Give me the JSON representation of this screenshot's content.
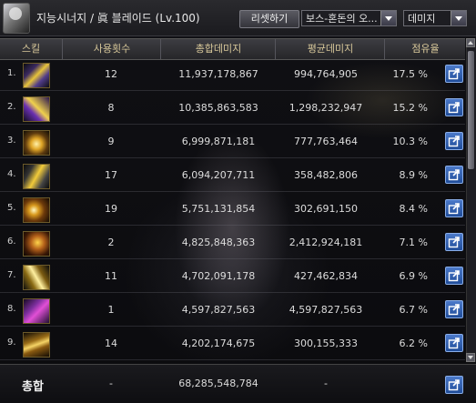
{
  "header": {
    "character_title": "지능시너지 / 眞 블레이드 (Lv.100)",
    "reset_button_label": "리셋하기",
    "dungeon_select_value": "보스-혼돈의 오...",
    "metric_select_value": "데미지"
  },
  "columns": {
    "skill": "스킬",
    "uses": "사용횟수",
    "total_damage": "총합데미지",
    "avg_damage": "평균데미지",
    "share": "점유율"
  },
  "rows": [
    {
      "rank": "1.",
      "uses": "12",
      "total": "11,937,178,867",
      "avg": "994,764,905",
      "pct": "17.5 %",
      "icon": "skill-icon-1"
    },
    {
      "rank": "2.",
      "uses": "8",
      "total": "10,385,863,583",
      "avg": "1,298,232,947",
      "pct": "15.2 %",
      "icon": "skill-icon-2"
    },
    {
      "rank": "3.",
      "uses": "9",
      "total": "6,999,871,181",
      "avg": "777,763,464",
      "pct": "10.3 %",
      "icon": "skill-icon-3"
    },
    {
      "rank": "4.",
      "uses": "17",
      "total": "6,094,207,711",
      "avg": "358,482,806",
      "pct": "8.9 %",
      "icon": "skill-icon-4"
    },
    {
      "rank": "5.",
      "uses": "19",
      "total": "5,751,131,854",
      "avg": "302,691,150",
      "pct": "8.4 %",
      "icon": "skill-icon-5"
    },
    {
      "rank": "6.",
      "uses": "2",
      "total": "4,825,848,363",
      "avg": "2,412,924,181",
      "pct": "7.1 %",
      "icon": "skill-icon-6"
    },
    {
      "rank": "7.",
      "uses": "11",
      "total": "4,702,091,178",
      "avg": "427,462,834",
      "pct": "6.9 %",
      "icon": "skill-icon-7"
    },
    {
      "rank": "8.",
      "uses": "1",
      "total": "4,597,827,563",
      "avg": "4,597,827,563",
      "pct": "6.7 %",
      "icon": "skill-icon-8"
    },
    {
      "rank": "9.",
      "uses": "14",
      "total": "4,202,174,675",
      "avg": "300,155,333",
      "pct": "6.2 %",
      "icon": "skill-icon-9"
    }
  ],
  "total_row": {
    "label": "총합",
    "uses": "-",
    "total": "68,285,548,784",
    "avg": "-"
  },
  "icons": {
    "share_icon": "share-icon",
    "scroll_up": "arrow-up-icon",
    "scroll_down": "arrow-down-icon"
  },
  "colors": {
    "header_text": "#d8c89a",
    "share_button": "#2f63b8"
  }
}
